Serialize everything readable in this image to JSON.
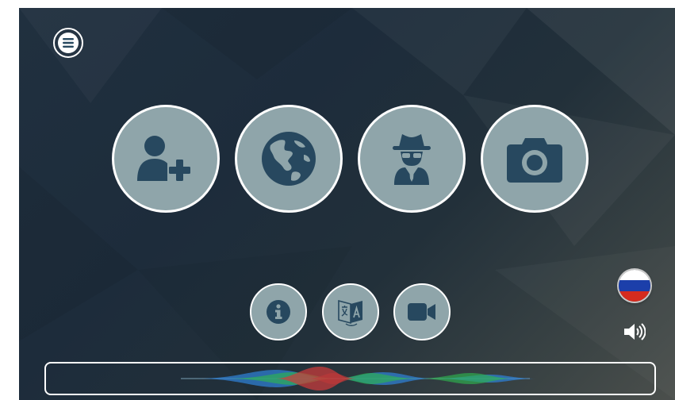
{
  "app": {
    "colors": {
      "button_fill": "#8fa5aa",
      "icon_fill": "#27485f",
      "outline": "#ffffff"
    }
  },
  "menu": {
    "icon": "hamburger-menu-icon"
  },
  "main_actions": [
    {
      "name": "add-contact",
      "icon": "user-plus-icon"
    },
    {
      "name": "globe",
      "icon": "globe-icon"
    },
    {
      "name": "incognito",
      "icon": "spy-icon"
    },
    {
      "name": "camera",
      "icon": "camera-icon"
    }
  ],
  "secondary_actions": [
    {
      "name": "info",
      "icon": "info-icon"
    },
    {
      "name": "translate",
      "icon": "translate-icon"
    },
    {
      "name": "video",
      "icon": "video-camera-icon"
    }
  ],
  "language": {
    "icon": "russia-flag-icon",
    "flag_colors": [
      "#ffffff",
      "#1c3faa",
      "#d52b1e"
    ]
  },
  "audio": {
    "icon": "speaker-volume-icon"
  },
  "voice_input": {
    "icon": "siri-waveform-icon",
    "wave_colors": [
      "#2f7fd1",
      "#2eb34f",
      "#d23a3a"
    ]
  }
}
